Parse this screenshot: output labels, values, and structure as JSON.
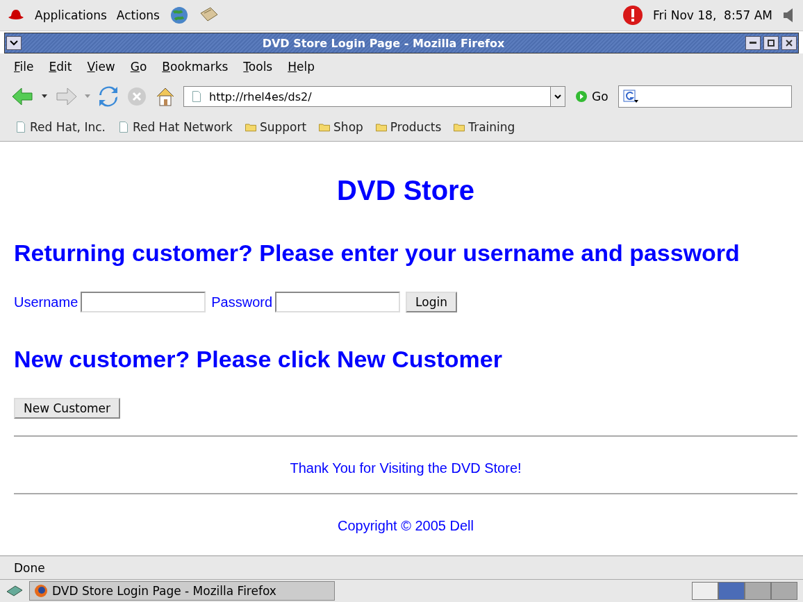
{
  "top_panel": {
    "menus": [
      "Applications",
      "Actions"
    ],
    "clock": "Fri Nov 18,  8:57 AM"
  },
  "window": {
    "title": "DVD Store Login Page - Mozilla Firefox"
  },
  "menu_bar": [
    "File",
    "Edit",
    "View",
    "Go",
    "Bookmarks",
    "Tools",
    "Help"
  ],
  "nav_toolbar": {
    "url": "http://rhel4es/ds2/",
    "go_label": "Go"
  },
  "bookmarks": [
    {
      "label": "Red Hat, Inc.",
      "kind": "page"
    },
    {
      "label": "Red Hat Network",
      "kind": "page"
    },
    {
      "label": "Support",
      "kind": "folder"
    },
    {
      "label": "Shop",
      "kind": "folder"
    },
    {
      "label": "Products",
      "kind": "folder"
    },
    {
      "label": "Training",
      "kind": "folder"
    }
  ],
  "page": {
    "title": "DVD Store",
    "returning_heading": "Returning customer? Please enter your username and password",
    "username_label": "Username",
    "password_label": "Password",
    "login_button": "Login",
    "new_heading": "New customer? Please click New Customer",
    "new_button": "New Customer",
    "thanks": "Thank You for Visiting the DVD Store!",
    "copyright": "Copyright © 2005 Dell"
  },
  "status_bar": {
    "text": "Done"
  },
  "taskbar": {
    "task": "DVD Store Login Page - Mozilla Firefox",
    "workspaces": [
      {
        "selected": false
      },
      {
        "selected": true
      },
      {
        "selected": false
      },
      {
        "selected": false
      }
    ]
  }
}
